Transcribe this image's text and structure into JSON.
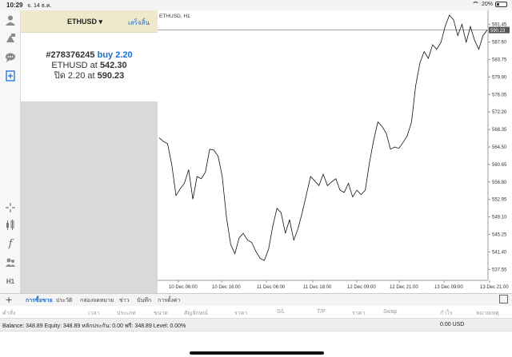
{
  "status_bar": {
    "time": "10:29",
    "date": "จ. 14 ธ.ค.",
    "battery_percent": "20%"
  },
  "order_panel": {
    "symbol": "ETHUSD",
    "dropdown_arrow": "▾",
    "done_label": "เสร็จสิ้น",
    "ticket": "#278376245",
    "side_lots": "buy 2.20",
    "open_prefix": "ETHUSD at",
    "open_price": "542.30",
    "close_prefix": "ปิด 2.20 at",
    "close_price": "590.23"
  },
  "chart": {
    "title": "ETHUSD, H1",
    "current_price": "590.23",
    "price_labels": [
      "591.45",
      "587.60",
      "583.75",
      "579.90",
      "576.05",
      "572.20",
      "568.35",
      "564.50",
      "560.65",
      "556.80",
      "552.95",
      "549.10",
      "545.25",
      "541.40",
      "537.55"
    ],
    "time_labels": [
      "10 Dec 06:00",
      "10 Dec 16:00",
      "11 Dec 06:00",
      "11 Dec 18:00",
      "12 Dec 09:00",
      "12 Dec 21:00",
      "13 Dec 09:00",
      "13 Dec 21:00"
    ]
  },
  "chart_data": {
    "type": "line",
    "title": "ETHUSD, H1",
    "ylim": [
      535.5,
      593.5
    ],
    "current_price": 590.23,
    "values": [
      566.5,
      565.7,
      565.2,
      560.5,
      553.8,
      555.3,
      556.5,
      559.5,
      553,
      558,
      557.5,
      559,
      564,
      563.8,
      562.5,
      558,
      549,
      543,
      541,
      544.5,
      545.5,
      544,
      543.5,
      541.5,
      540,
      539.5,
      542,
      547,
      551,
      550,
      545.5,
      548.5,
      544,
      546.5,
      550,
      554,
      558,
      557,
      556,
      558.5,
      556,
      556.8,
      557.5,
      555,
      554.5,
      556.5,
      553.5,
      555,
      554,
      555,
      561,
      566,
      570,
      569,
      567.5,
      564,
      564.5,
      564.2,
      565.5,
      567,
      570,
      578,
      583,
      585.5,
      584,
      587,
      586,
      587.5,
      591,
      593.5,
      592.5,
      589,
      591.5,
      587.5,
      591,
      588,
      586,
      589,
      590.23
    ],
    "legend": "none",
    "grid": false
  },
  "tabs": {
    "items": [
      {
        "label": "การซื้อขาย",
        "active": true
      },
      {
        "label": "ประวัติ",
        "active": false
      },
      {
        "label": "กล่องจดหมาย",
        "active": false
      },
      {
        "label": "ข่าว",
        "active": false
      },
      {
        "label": "บันทึก",
        "active": false
      },
      {
        "label": "การตั้งค่า",
        "active": false
      }
    ]
  },
  "table_header": {
    "columns": [
      "คำสั่ง",
      "เวลา",
      "ประเภท",
      "ขนาด",
      "สัญลักษณ์",
      "ราคา",
      "S/L",
      "T/P",
      "ราคา",
      "Swap",
      "กำไร",
      "หมายเหตุ"
    ]
  },
  "balance": {
    "summary": "Balance: 348.89 Equity: 348.89 หลักประกัน: 0.00 ฟรี: 348.89 Level: 0.00%",
    "amount": "0.00  USD"
  },
  "colors": {
    "accent": "#1a6fd1",
    "header_bg": "#efe9cc",
    "gray_area": "#d9d9d9"
  }
}
